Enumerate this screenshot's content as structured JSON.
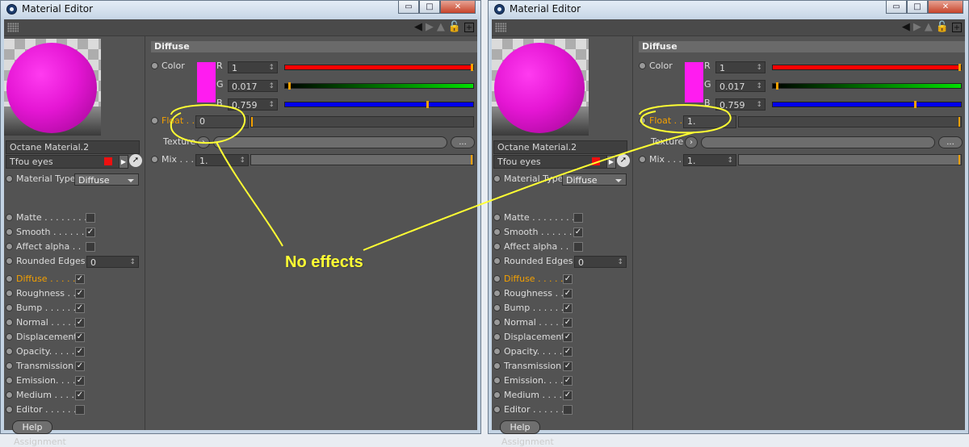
{
  "windows": [
    {
      "title": "Material Editor",
      "window_controls": {
        "minimize": "▭",
        "maximize": "□",
        "close": "✕"
      },
      "material_name": "Octane Material.2",
      "tag_name": "Tfou eyes",
      "material_type": {
        "label": "Material Type",
        "value": "Diffuse"
      },
      "channels": [
        {
          "label": "Matte . . . . . . . . .",
          "checked": false,
          "active": false
        },
        {
          "label": "Smooth . . . . . .",
          "checked": true,
          "active": false
        },
        {
          "label": "Affect alpha . .",
          "checked": false,
          "active": false
        },
        {
          "label": "Diffuse . . . . .",
          "checked": true,
          "active": true
        },
        {
          "label": "Roughness . .",
          "checked": true,
          "active": false
        },
        {
          "label": "Bump . . . . . .",
          "checked": true,
          "active": false
        },
        {
          "label": "Normal . . . . .",
          "checked": true,
          "active": false
        },
        {
          "label": "Displacement",
          "checked": true,
          "active": false
        },
        {
          "label": "Opacity. . . . .",
          "checked": true,
          "active": false
        },
        {
          "label": "Transmission",
          "checked": true,
          "active": false
        },
        {
          "label": "Emission. . . .",
          "checked": true,
          "active": false
        },
        {
          "label": "Medium . . . .",
          "checked": true,
          "active": false
        },
        {
          "label": "Editor . . . . . .",
          "checked": false,
          "active": false
        }
      ],
      "rounded_edges": {
        "label": "Rounded Edges",
        "value": "0"
      },
      "help_label": "Help",
      "assignment_label": "Assignment",
      "diffuse": {
        "section": "Diffuse",
        "color_label": "Color",
        "swatch_color": "#ff1cf0",
        "r": {
          "label": "R",
          "value": "1",
          "fraction": 1.0
        },
        "g": {
          "label": "G",
          "value": "0.017",
          "fraction": 0.017
        },
        "b": {
          "label": "B",
          "value": "0.759",
          "fraction": 0.759
        },
        "float": {
          "label": "Float . .",
          "value": "0",
          "fraction": 0.0
        },
        "texture_label": "Texture",
        "texture_button": "...",
        "mix": {
          "label": "Mix . . .",
          "value": "1.",
          "fraction": 1.0
        }
      }
    },
    {
      "title": "Material Editor",
      "window_controls": {
        "minimize": "▭",
        "maximize": "□",
        "close": "✕"
      },
      "material_name": "Octane Material.2",
      "tag_name": "Tfou eyes",
      "material_type": {
        "label": "Material Type",
        "value": "Diffuse"
      },
      "channels": [
        {
          "label": "Matte . . . . . . . . .",
          "checked": false,
          "active": false
        },
        {
          "label": "Smooth . . . . . .",
          "checked": true,
          "active": false
        },
        {
          "label": "Affect alpha . .",
          "checked": false,
          "active": false
        },
        {
          "label": "Diffuse . . . . .",
          "checked": true,
          "active": true
        },
        {
          "label": "Roughness . .",
          "checked": true,
          "active": false
        },
        {
          "label": "Bump . . . . . .",
          "checked": true,
          "active": false
        },
        {
          "label": "Normal . . . . .",
          "checked": true,
          "active": false
        },
        {
          "label": "Displacement",
          "checked": true,
          "active": false
        },
        {
          "label": "Opacity. . . . .",
          "checked": true,
          "active": false
        },
        {
          "label": "Transmission",
          "checked": true,
          "active": false
        },
        {
          "label": "Emission. . . .",
          "checked": true,
          "active": false
        },
        {
          "label": "Medium . . . .",
          "checked": true,
          "active": false
        },
        {
          "label": "Editor . . . . . .",
          "checked": false,
          "active": false
        }
      ],
      "rounded_edges": {
        "label": "Rounded Edges",
        "value": "0"
      },
      "help_label": "Help",
      "assignment_label": "Assignment",
      "diffuse": {
        "section": "Diffuse",
        "color_label": "Color",
        "swatch_color": "#ff1cf0",
        "r": {
          "label": "R",
          "value": "1",
          "fraction": 1.0
        },
        "g": {
          "label": "G",
          "value": "0.017",
          "fraction": 0.017
        },
        "b": {
          "label": "B",
          "value": "0.759",
          "fraction": 0.759
        },
        "float": {
          "label": "Float . .",
          "value": "1.",
          "fraction": 1.0
        },
        "texture_label": "Texture",
        "texture_button": "...",
        "mix": {
          "label": "Mix . . .",
          "value": "1.",
          "fraction": 1.0
        }
      }
    }
  ],
  "annotation": {
    "text": "No effects",
    "color": "#ffff33"
  },
  "colors": {
    "red": "#ff0000",
    "green": "#00e000",
    "blue": "#0000ee",
    "accent": "#f4a000"
  }
}
